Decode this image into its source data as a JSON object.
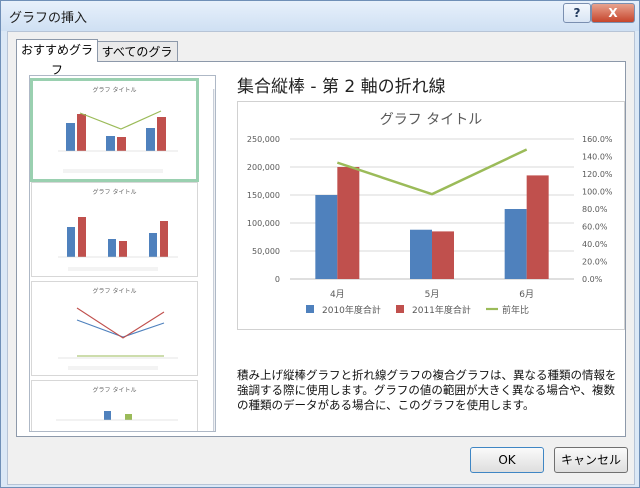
{
  "window": {
    "title": "グラフの挿入",
    "help_button": "?",
    "close_button": "X"
  },
  "tabs": [
    {
      "label": "おすすめグラフ",
      "active": true
    },
    {
      "label": "すべてのグラフ",
      "active": false
    }
  ],
  "thumbnails": {
    "caption": "グラフ タイトル",
    "items": [
      {
        "type": "combo-bar-line",
        "selected": true
      },
      {
        "type": "clustered-bar",
        "selected": false
      },
      {
        "type": "line",
        "selected": false
      },
      {
        "type": "clustered-bar",
        "selected": false
      }
    ]
  },
  "chart_data": {
    "type": "bar",
    "title": "グラフ タイトル",
    "categories": [
      "4月",
      "5月",
      "6月"
    ],
    "series": [
      {
        "name": "2010年度合計",
        "values": [
          150000,
          88000,
          125000
        ],
        "color": "#4f81bd",
        "axis": "left"
      },
      {
        "name": "2011年度合計",
        "values": [
          200000,
          85000,
          185000
        ],
        "color": "#c0504d",
        "axis": "left"
      },
      {
        "name": "前年比",
        "values": [
          1.33,
          0.97,
          1.48
        ],
        "color": "#9bbb59",
        "axis": "right",
        "type": "line"
      }
    ],
    "y_left": {
      "range": [
        0,
        250000
      ],
      "ticks": [
        "0",
        "50,000",
        "100,000",
        "150,000",
        "200,000",
        "250,000"
      ]
    },
    "y_right": {
      "range": [
        0,
        1.6
      ],
      "ticks": [
        "0.0%",
        "20.0%",
        "40.0%",
        "60.0%",
        "80.0%",
        "100.0%",
        "120.0%",
        "140.0%",
        "160.0%"
      ]
    },
    "legend": "bottom"
  },
  "main": {
    "heading": "集合縦棒 - 第 2 軸の折れ線",
    "description": "積み上げ縦棒グラフと折れ線グラフの複合グラフは、異なる種類の情報を強調する際に使用します。グラフの値の範囲が大きく異なる場合や、複数の種類のデータがある場合に、このグラフを使用します。"
  },
  "buttons": {
    "ok": "OK",
    "cancel": "キャンセル"
  },
  "colors": {
    "selection": "#9ad0b0",
    "accent_blue": "#4f81bd",
    "accent_red": "#c0504d",
    "accent_green": "#9bbb59"
  },
  "scroll": {
    "up_arrow": "▲",
    "down_arrow": "▼"
  }
}
